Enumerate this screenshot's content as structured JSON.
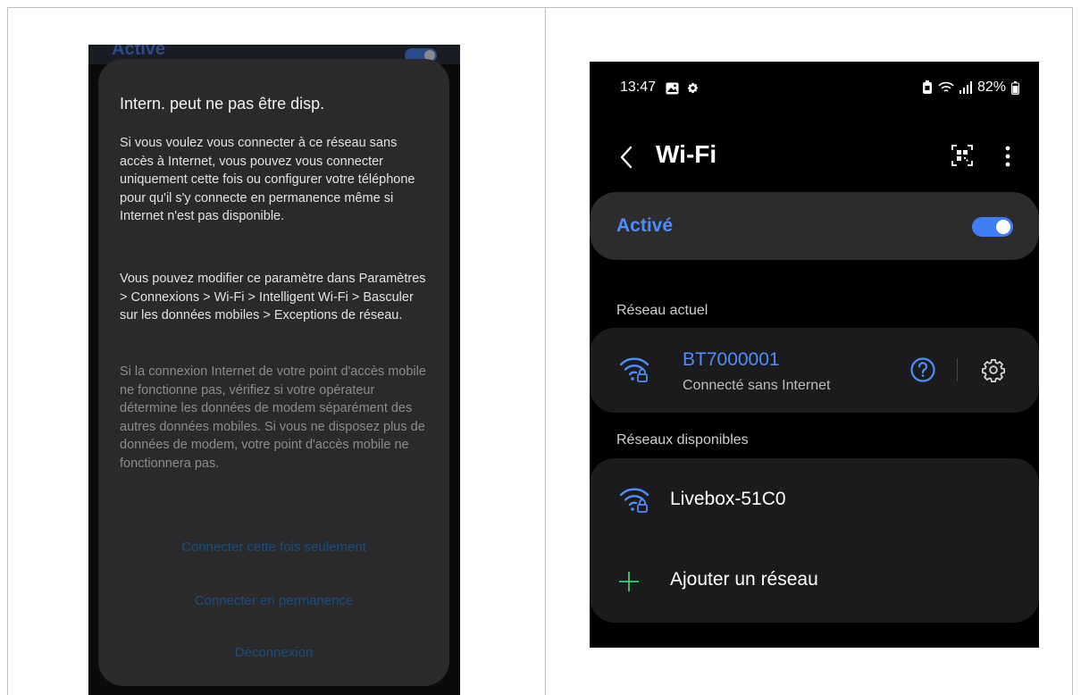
{
  "left_screen": {
    "behind_toggle_label": "Activé",
    "dialog": {
      "title": "Intern. peut ne pas être disp.",
      "paragraph_1": "Si vous voulez vous connecter à ce réseau sans accès à Internet, vous pouvez vous connecter uniquement cette fois ou configurer votre téléphone pour qu'il s'y connecte en permanence même si Internet n'est pas disponible.",
      "paragraph_2": "Vous pouvez modifier ce paramètre dans Paramètres > Connexions > Wi-Fi > Intelligent Wi-Fi > Basculer sur les données mobiles > Exceptions de réseau.",
      "paragraph_3": "Si la connexion Internet de votre point d'accès mobile ne fonctionne pas, vérifiez si votre opérateur détermine les données de modem séparément des autres données mobiles. Si vous ne disposez plus de données de modem, votre point d'accès mobile ne fonctionnera pas.",
      "actions": {
        "connect_once": "Connecter cette fois seulement",
        "connect_always": "Connecter en permanence",
        "disconnect": "Déconnexion"
      }
    }
  },
  "right_screen": {
    "status_bar": {
      "time": "13:47",
      "battery": "82%"
    },
    "header": {
      "title": "Wi-Fi"
    },
    "wifi_toggle": {
      "label": "Activé",
      "on": true
    },
    "current_network": {
      "section_label": "Réseau actuel",
      "name": "BT7000001",
      "status": "Connecté sans Internet"
    },
    "available_networks": {
      "section_label": "Réseaux disponibles",
      "items": [
        {
          "name": "Livebox-51C0"
        }
      ],
      "add_label": "Ajouter un réseau"
    },
    "colors": {
      "accent": "#4f8df7",
      "toggle_on": "#3f7ef2",
      "add_plus": "#3ecf6a",
      "dialog_bg": "#2a2a2d",
      "dialog_action": "#1c4d7a"
    }
  }
}
